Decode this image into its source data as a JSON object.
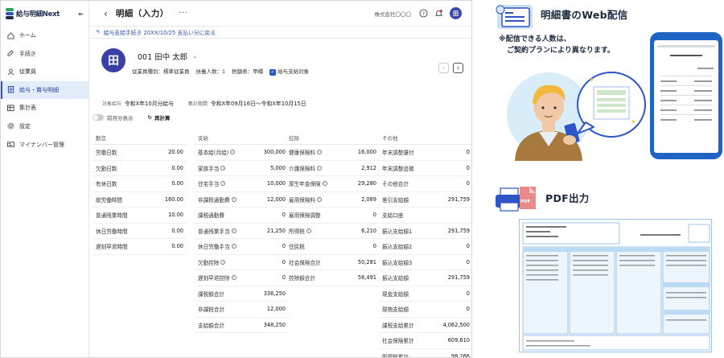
{
  "app": {
    "logo_small": "サービス",
    "logo_text": "給与明細Next",
    "page_title": "明細（入力）",
    "company": "株式会社〇〇〇",
    "user_initial": "田",
    "backlink": "給与支給手続き 20XX/10/25 支払い分に戻る",
    "nav": [
      {
        "label": "ホーム",
        "icon": "home-icon"
      },
      {
        "label": "手続き",
        "icon": "procedure-icon"
      },
      {
        "label": "従業員",
        "icon": "person-icon"
      },
      {
        "label": "給与・賞与明細",
        "icon": "document-icon",
        "active": true
      },
      {
        "label": "集計表",
        "icon": "table-icon"
      },
      {
        "label": "設定",
        "icon": "gear-icon"
      },
      {
        "label": "マイナンバー管理",
        "icon": "id-card-icon"
      }
    ],
    "employee": {
      "initial": "田",
      "name": "001 田中 太郎",
      "type": "従業員種別：標準従業員",
      "dependents": "扶養人数：1",
      "tax": "税額表：甲欄",
      "payment_target": "給与支給対象"
    },
    "period": {
      "target_label": "対象給与",
      "target_value": "令和X年10月分給与",
      "calc_label": "集計期間",
      "calc_value": "令和X年09月16日〜令和X年10月15日"
    },
    "toggle_label": "前月分表示",
    "recalc": "再計算",
    "columns": [
      {
        "head": "勤怠",
        "rows": [
          {
            "k": "労働日数",
            "v": "20.00"
          },
          {
            "k": "欠勤日数",
            "v": "0.00"
          },
          {
            "k": "有休日数",
            "v": "0.00"
          },
          {
            "k": "総労働時間",
            "v": "160.00"
          },
          {
            "k": "普通残業時間",
            "v": "10.00"
          },
          {
            "k": "休日労働時間",
            "v": "0.00"
          },
          {
            "k": "遅刻早退時間",
            "v": "0.00"
          }
        ]
      },
      {
        "head": "支給",
        "rows": [
          {
            "k": "基本給(月給)",
            "v": "300,000",
            "info": true
          },
          {
            "k": "家族手当",
            "v": "5,000",
            "info": true
          },
          {
            "k": "住宅手当",
            "v": "10,000",
            "info": true
          },
          {
            "k": "非課税通勤費",
            "v": "12,000",
            "info": true
          },
          {
            "k": "課税通勤費",
            "v": "0"
          },
          {
            "k": "普通残業手当",
            "v": "21,250",
            "info": true
          },
          {
            "k": "休日労働手当",
            "v": "0",
            "info": true
          },
          {
            "k": "欠勤控除",
            "v": "0",
            "info": true
          },
          {
            "k": "遅刻早退控除",
            "v": "0",
            "info": true
          },
          {
            "k": "課税額合計",
            "v": "336,250"
          },
          {
            "k": "非課税合計",
            "v": "12,000"
          },
          {
            "k": "支給額合計",
            "v": "348,250"
          }
        ]
      },
      {
        "head": "控除",
        "rows": [
          {
            "k": "健康保険料",
            "v": "16,000",
            "info": true
          },
          {
            "k": "介護保険料",
            "v": "2,912",
            "info": true
          },
          {
            "k": "厚生年金保険",
            "v": "29,280",
            "info": true
          },
          {
            "k": "雇用保険料",
            "v": "2,089",
            "info": true
          },
          {
            "k": "雇用保険調整",
            "v": "0"
          },
          {
            "k": "所得税",
            "v": "6,210",
            "info": true
          },
          {
            "k": "住民税",
            "v": "0"
          },
          {
            "k": "社会保険合計",
            "v": "50,281"
          },
          {
            "k": "控除額合計",
            "v": "56,491"
          }
        ]
      },
      {
        "head": "その他",
        "rows": [
          {
            "k": "年末調整還付",
            "v": "0"
          },
          {
            "k": "年末調整追徴",
            "v": "0"
          },
          {
            "k": "その他合計",
            "v": "0"
          },
          {
            "k": "差引支給額",
            "v": "291,759"
          },
          {
            "k": "支給口座",
            "v": ""
          },
          {
            "k": "振込支給額1",
            "v": "291,759"
          },
          {
            "k": "振込支給額2",
            "v": "0"
          },
          {
            "k": "振込支給額3",
            "v": "0"
          },
          {
            "k": "振込支給額",
            "v": "291,759"
          },
          {
            "k": "現金支給額",
            "v": "0"
          },
          {
            "k": "現物支給額",
            "v": "0"
          },
          {
            "k": "課税支給累計",
            "v": "4,062,500"
          },
          {
            "k": "社会保険累計",
            "v": "609,610"
          },
          {
            "k": "所得税累計",
            "v": "98,266"
          }
        ]
      }
    ]
  },
  "promo": {
    "web_title": "明細書のWeb配信",
    "note_line1": "※配信できる人数は、",
    "note_line2": "ご契約プランにより異なります。",
    "pdf_title": "PDF出力",
    "pdf_badge": "PDF"
  },
  "colors": {
    "accent": "#2d55c8",
    "phone": "#1f63c4",
    "avatar": "#3b3fa8"
  }
}
